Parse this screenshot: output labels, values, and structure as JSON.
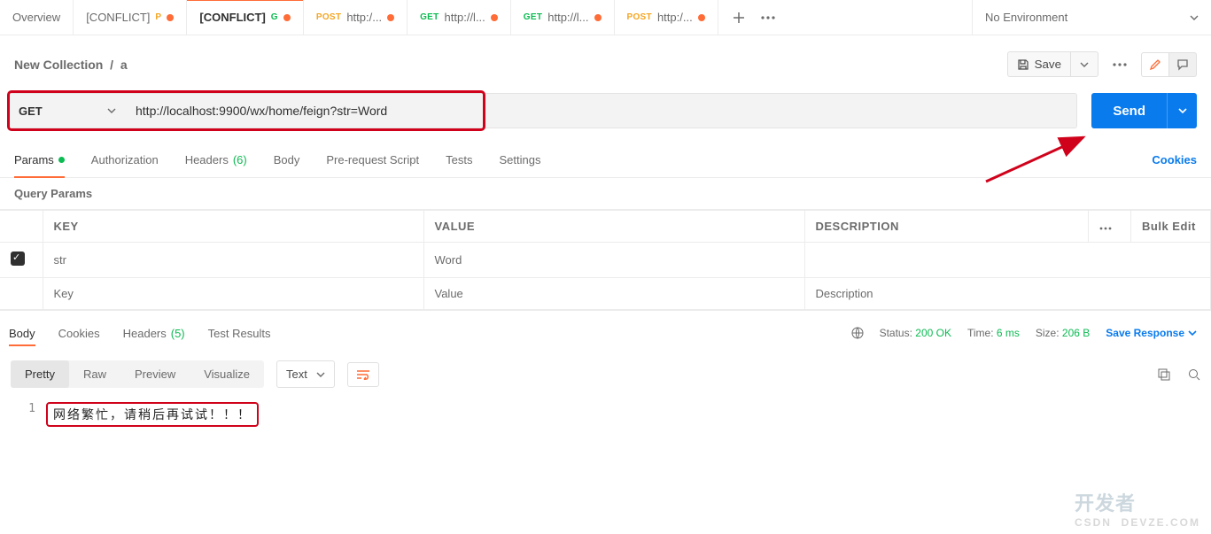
{
  "tabs": {
    "overview": "Overview",
    "items": [
      {
        "label": "[CONFLICT]",
        "method": "POST",
        "mshort": "P"
      },
      {
        "label": "[CONFLICT]",
        "method": "GET",
        "mshort": "G"
      },
      {
        "label": "http:/...",
        "method": "POST",
        "mshort": "POST"
      },
      {
        "label": "http://l...",
        "method": "GET",
        "mshort": "GET"
      },
      {
        "label": "http://l...",
        "method": "GET",
        "mshort": "GET"
      },
      {
        "label": "http:/...",
        "method": "POST",
        "mshort": "POST"
      }
    ],
    "env": "No Environment"
  },
  "breadcrumb": {
    "collection": "New Collection",
    "sep": "/",
    "item": "a"
  },
  "toolbar": {
    "save": "Save"
  },
  "request": {
    "method": "GET",
    "url": "http://localhost:9900/wx/home/feign?str=Word",
    "send": "Send",
    "tabs": {
      "params": "Params",
      "auth": "Authorization",
      "headers": "Headers",
      "headers_count": "(6)",
      "body": "Body",
      "prescript": "Pre-request Script",
      "tests": "Tests",
      "settings": "Settings",
      "cookies": "Cookies"
    }
  },
  "qp": {
    "title": "Query Params",
    "columns": {
      "key": "KEY",
      "value": "VALUE",
      "desc": "DESCRIPTION",
      "bulk": "Bulk Edit"
    },
    "rows": [
      {
        "checked": true,
        "key": "str",
        "value": "Word",
        "desc": ""
      }
    ],
    "placeholders": {
      "key": "Key",
      "value": "Value",
      "desc": "Description"
    }
  },
  "response": {
    "tabs": {
      "body": "Body",
      "cookies": "Cookies",
      "headers": "Headers",
      "headers_count": "(5)",
      "tests": "Test Results"
    },
    "status_label": "Status:",
    "status_value": "200 OK",
    "time_label": "Time:",
    "time_value": "6 ms",
    "size_label": "Size:",
    "size_value": "206 B",
    "save": "Save Response"
  },
  "viewer": {
    "tabs": {
      "pretty": "Pretty",
      "raw": "Raw",
      "preview": "Preview",
      "visualize": "Visualize"
    },
    "format": "Text"
  },
  "body_lines": [
    "网络繁忙，请稍后再试试！！！"
  ],
  "watermark": {
    "brand": "开发者",
    "sub": "DEVZE.COM",
    "csdn": "CSDN"
  }
}
